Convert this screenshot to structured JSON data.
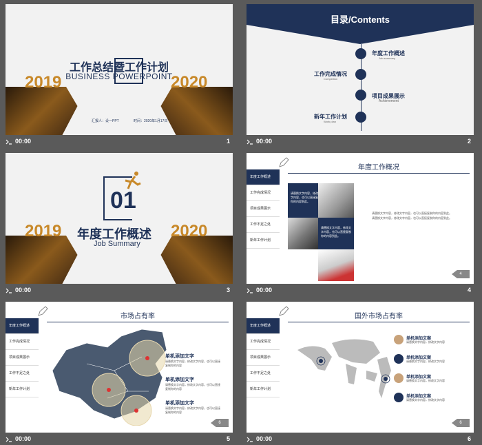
{
  "slides": [
    {
      "num": "1",
      "time": "00:00",
      "title": "工作总结暨工作计划",
      "subtitle": "BUSINESS POWERPOINT",
      "year_left": "2019",
      "year_right": "2020",
      "reporter": "汇报人：设一PPT",
      "date": "时间：2020年1月17日"
    },
    {
      "num": "2",
      "time": "00:00",
      "title": "目录/Contents",
      "items": [
        {
          "cn": "年度工作概述",
          "en": "Job summary"
        },
        {
          "cn": "工作完成情况",
          "en": "Completion"
        },
        {
          "cn": "项目成果展示",
          "en": "Achievement"
        },
        {
          "cn": "新年工作计划",
          "en": "Work plan"
        }
      ]
    },
    {
      "num": "3",
      "time": "00:00",
      "index": "01",
      "title": "年度工作概述",
      "subtitle": "Job Summary",
      "year_left": "2019",
      "year_right": "2020"
    },
    {
      "num": "4",
      "time": "00:00",
      "title": "年度工作概况",
      "page_tag": "4",
      "box_text": "请替换文字内容，修改文字内容，也可以直接复制你的内容到此。",
      "body": "请替换文字内容，修改文字内容，也可以直接复制你的内容到此。请替换文字内容，修改文字内容，也可以直接复制你的内容到此。"
    },
    {
      "num": "5",
      "time": "00:00",
      "title": "市场占有率",
      "page_tag": "6",
      "points": [
        {
          "title": "单机添加文字",
          "desc": "请替换文字内容，修改文字内容，也可以直接复制你的内容"
        },
        {
          "title": "单机添加文字",
          "desc": "请替换文字内容，修改文字内容，也可以直接复制你的内容"
        },
        {
          "title": "单机添加文字",
          "desc": "请替换文字内容，修改文字内容，也可以直接复制你的内容"
        }
      ]
    },
    {
      "num": "6",
      "time": "00:00",
      "title": "国外市场占有率",
      "page_tag": "6",
      "points": [
        {
          "title": "单机添加文案",
          "desc": "请替换文字内容，修改文字内容"
        },
        {
          "title": "单机添加文案",
          "desc": "请替换文字内容，修改文字内容"
        },
        {
          "title": "单机添加文案",
          "desc": "请替换文字内容，修改文字内容"
        },
        {
          "title": "单机添加文案",
          "desc": "请替换文字内容，修改文字内容"
        }
      ]
    }
  ],
  "sidebar": [
    "年度工作概述",
    "工作完成情况",
    "项目成果展示",
    "工作不足之处",
    "新年工作计划"
  ],
  "colors": {
    "navy": "#1f3258",
    "gold": "#c8892a",
    "bg": "#5a5a5a"
  }
}
